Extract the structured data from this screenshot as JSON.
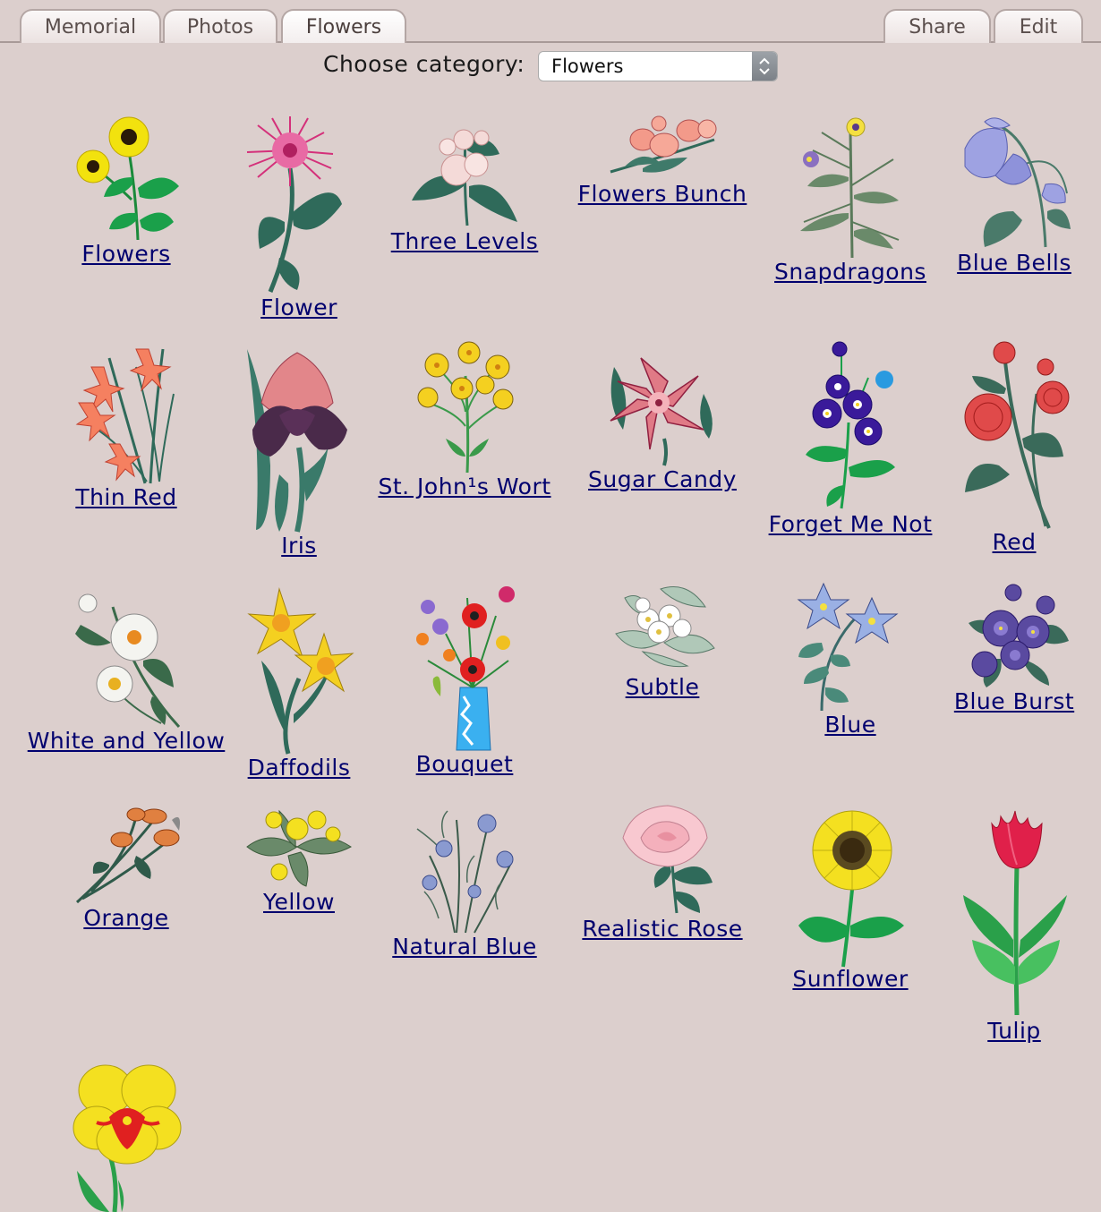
{
  "tabs": {
    "memorial": "Memorial",
    "photos": "Photos",
    "flowers": "Flowers",
    "share": "Share",
    "edit": "Edit"
  },
  "category": {
    "label": "Choose category:",
    "selected": "Flowers"
  },
  "flowers": [
    {
      "label": "Flowers",
      "icon": "sunflower-cluster-icon"
    },
    {
      "label": "Flower",
      "icon": "pink-aster-icon"
    },
    {
      "label": "Three Levels",
      "icon": "three-levels-icon"
    },
    {
      "label": "Flowers Bunch",
      "icon": "flowers-bunch-icon"
    },
    {
      "label": "Snapdragons",
      "icon": "snapdragons-icon"
    },
    {
      "label": "Blue Bells",
      "icon": "bluebells-icon"
    },
    {
      "label": "Thin Red",
      "icon": "thin-red-lily-icon"
    },
    {
      "label": "Iris",
      "icon": "iris-icon"
    },
    {
      "label": "St. John¹s Wort",
      "icon": "st-johns-wort-icon"
    },
    {
      "label": "Sugar Candy",
      "icon": "sugar-candy-lily-icon"
    },
    {
      "label": "Forget Me Not",
      "icon": "forget-me-not-icon"
    },
    {
      "label": "Red",
      "icon": "red-carnation-icon"
    },
    {
      "label": "White and Yellow",
      "icon": "white-daisy-icon"
    },
    {
      "label": "Daffodils",
      "icon": "daffodils-icon"
    },
    {
      "label": "Bouquet",
      "icon": "bouquet-vase-icon"
    },
    {
      "label": "Subtle",
      "icon": "subtle-white-flowers-icon"
    },
    {
      "label": "Blue",
      "icon": "blue-star-flowers-icon"
    },
    {
      "label": "Blue Burst",
      "icon": "blue-burst-icon"
    },
    {
      "label": "Orange",
      "icon": "orange-flowers-icon"
    },
    {
      "label": "Yellow",
      "icon": "yellow-flowers-icon"
    },
    {
      "label": "Natural Blue",
      "icon": "natural-blue-icon"
    },
    {
      "label": "Realistic Rose",
      "icon": "pink-rose-icon"
    },
    {
      "label": "Sunflower",
      "icon": "sunflower-icon"
    },
    {
      "label": "Tulip",
      "icon": "red-tulip-icon"
    },
    {
      "label": "",
      "icon": "yellow-pansy-icon"
    }
  ]
}
